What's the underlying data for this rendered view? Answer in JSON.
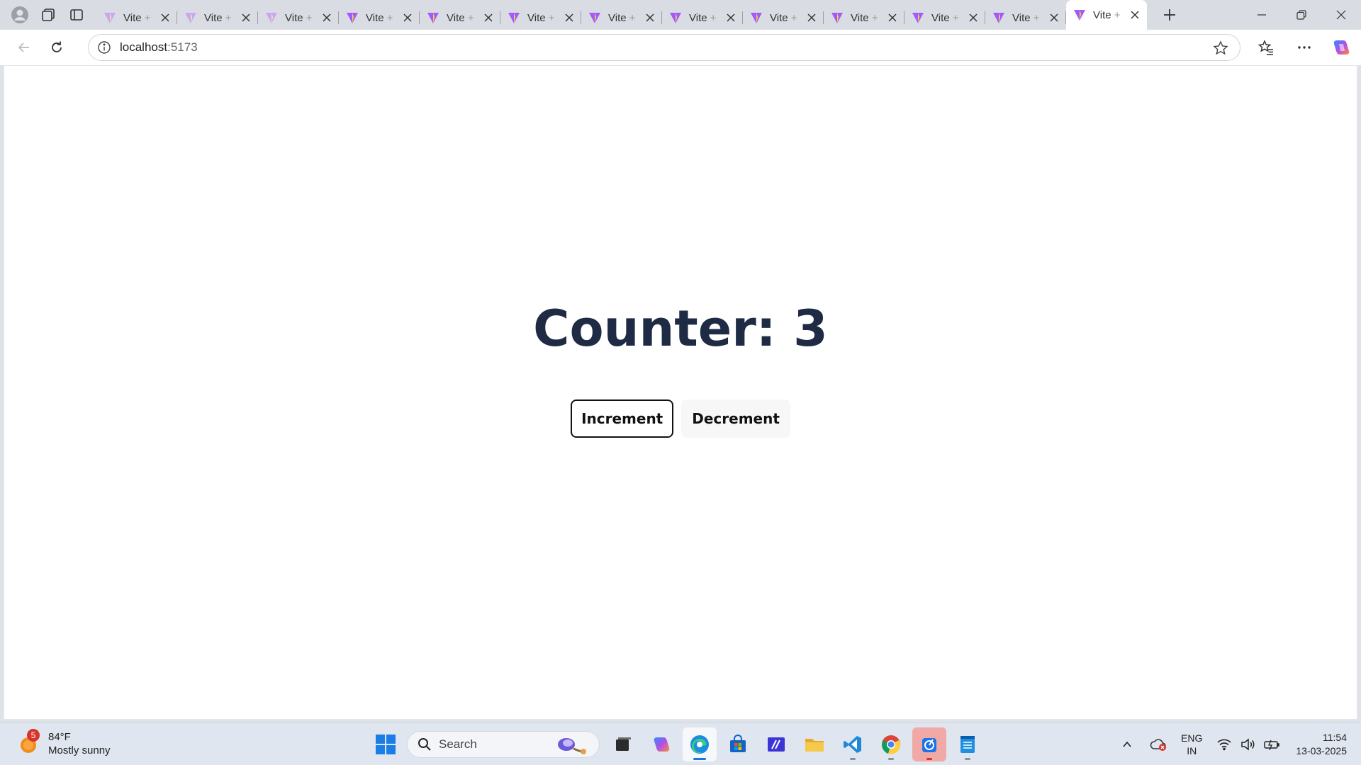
{
  "browser": {
    "tabs": [
      {
        "title": "Vite + React"
      },
      {
        "title": "Vite + React"
      },
      {
        "title": "Vite + React"
      },
      {
        "title": "Vite + React"
      },
      {
        "title": "Vite + React"
      },
      {
        "title": "Vite + React"
      },
      {
        "title": "Vite + React"
      },
      {
        "title": "Vite + React"
      },
      {
        "title": "Vite + React"
      },
      {
        "title": "Vite + React"
      },
      {
        "title": "Vite + React"
      },
      {
        "title": "Vite + React"
      },
      {
        "title": "Vite + React",
        "active": true
      }
    ],
    "tab_title_main": "Vite",
    "tab_title_fade": " +",
    "url_host": "localhost",
    "url_port": ":5173"
  },
  "page": {
    "counter_title": "Counter: 3",
    "increment_label": "Increment",
    "decrement_label": "Decrement"
  },
  "taskbar": {
    "weather_badge": "5",
    "weather_temp": "84°F",
    "weather_desc": "Mostly sunny",
    "search_placeholder": "Search",
    "lang_line1": "ENG",
    "lang_line2": "IN",
    "time": "11:54",
    "date": "13-03-2025"
  },
  "colors": {
    "title_text": "#1f2a44",
    "vite_purple": "#a259ff",
    "vite_yellow": "#ffd62e"
  }
}
